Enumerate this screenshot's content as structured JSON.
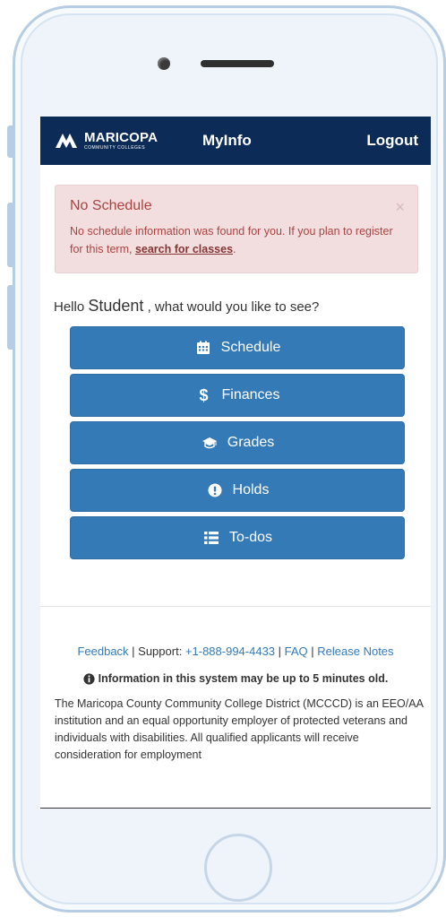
{
  "navbar": {
    "logo_main": "MARICOPA",
    "logo_sub": "COMMUNITY COLLEGES",
    "myinfo_label": "MyInfo",
    "logout_label": "Logout"
  },
  "alert": {
    "title": "No Schedule",
    "message_prefix": "No schedule information was found for you. If you plan to register for this term, ",
    "link_text": "search for classes",
    "message_suffix": ".",
    "close_glyph": "×"
  },
  "greeting": {
    "prefix": "Hello ",
    "name": "Student",
    "suffix": " , what would you like to see?"
  },
  "menu": [
    {
      "label": "Schedule",
      "icon": "calendar-icon"
    },
    {
      "label": "Finances",
      "icon": "dollar-icon"
    },
    {
      "label": "Grades",
      "icon": "graduation-cap-icon"
    },
    {
      "label": "Holds",
      "icon": "exclamation-circle-icon"
    },
    {
      "label": "To-dos",
      "icon": "list-icon"
    }
  ],
  "footer": {
    "feedback": "Feedback",
    "sep": " | ",
    "support_label": "Support: ",
    "support_phone": "+1-888-994-4433",
    "faq": "FAQ",
    "release_notes": "Release Notes",
    "info_notice": "Information in this system may be up to 5 minutes old.",
    "disclaimer": "The Maricopa County Community College District (MCCCD) is an EEO/AA institution and an equal opportunity employer of protected veterans and individuals with disabilities. All qualified applicants will receive consideration for employment"
  },
  "colors": {
    "navbar": "#0d2b57",
    "button": "#337ab7",
    "alert_bg": "#f2dede",
    "alert_text": "#a94442",
    "frame": "#b7cde3"
  }
}
